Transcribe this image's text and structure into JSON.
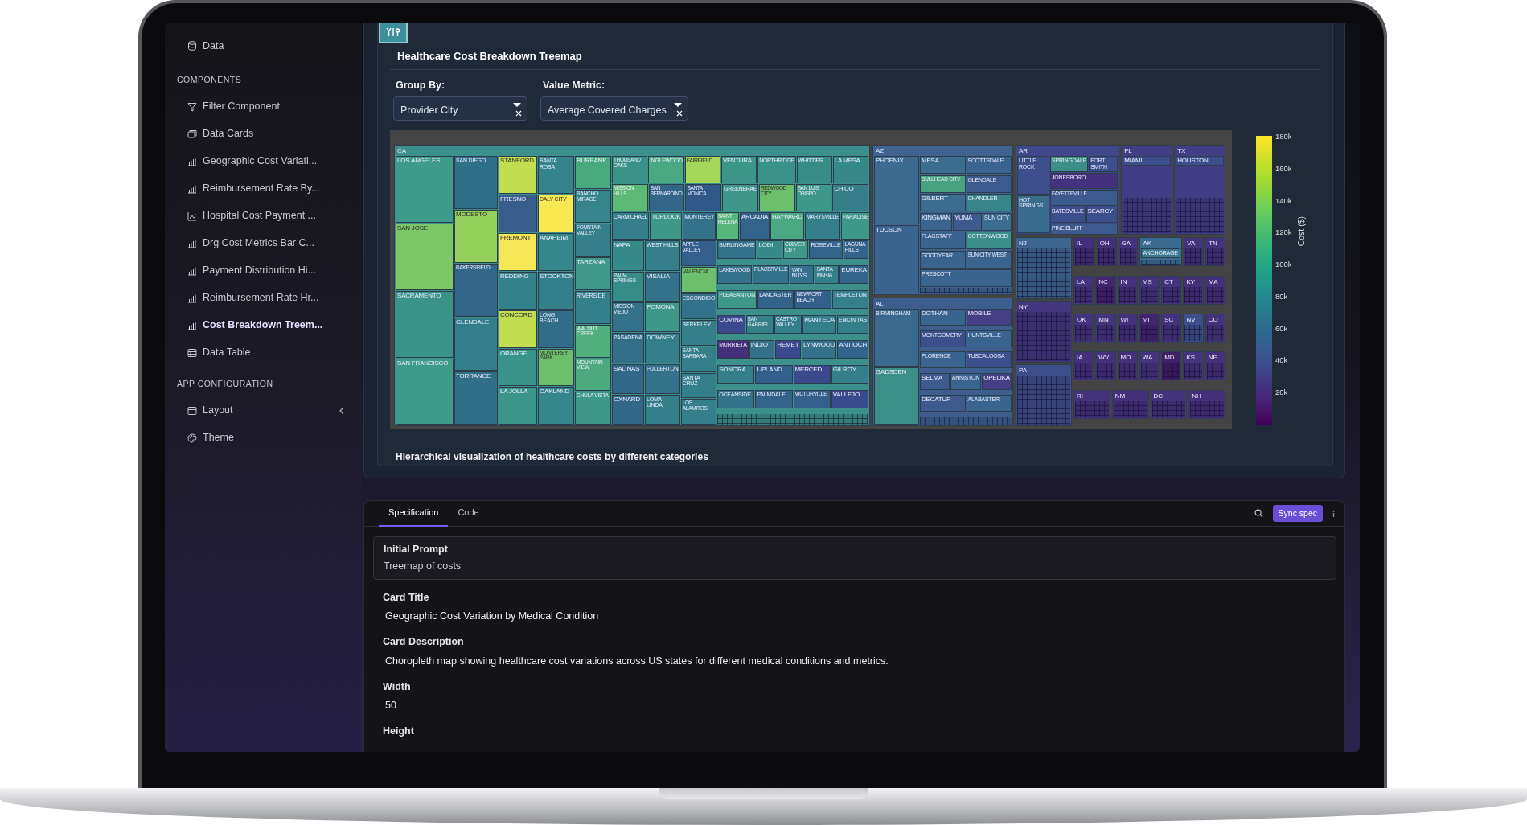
{
  "sidebar": {
    "sections": [
      {
        "items": [
          {
            "label": "Data",
            "kind": "database",
            "selected": false
          }
        ]
      },
      {
        "heading": "COMPONENTS",
        "items": [
          {
            "label": "Filter Component",
            "kind": "filter",
            "selected": false
          },
          {
            "label": "Data Cards",
            "kind": "cards",
            "selected": false
          },
          {
            "label": "Geographic Cost Variati...",
            "kind": "bars",
            "selected": false
          },
          {
            "label": "Reimbursement Rate By...",
            "kind": "bars",
            "selected": false
          },
          {
            "label": "Hospital Cost Payment ...",
            "kind": "scatter",
            "selected": false
          },
          {
            "label": "Drg Cost Metrics Bar C...",
            "kind": "bars",
            "selected": false
          },
          {
            "label": "Payment Distribution Hi...",
            "kind": "bars",
            "selected": false
          },
          {
            "label": "Reimbursement Rate Hr...",
            "kind": "bars",
            "selected": false
          },
          {
            "label": "Cost Breakdown Treem...",
            "kind": "bars",
            "selected": true
          },
          {
            "label": "Data Table",
            "kind": "table",
            "selected": false
          }
        ]
      },
      {
        "heading": "APP CONFIGURATION",
        "items": [
          {
            "label": "Layout",
            "kind": "layout",
            "selected": false
          },
          {
            "label": "Theme",
            "kind": "palette",
            "selected": false
          }
        ]
      }
    ]
  },
  "chart": {
    "title": "Healthcare Cost Breakdown Treemap",
    "filters": [
      {
        "label": "Group By:",
        "value": "Provider City"
      },
      {
        "label": "Value Metric:",
        "value": "Average Covered Charges"
      }
    ],
    "treemap": {
      "states": [
        {
          "label": "CA",
          "color": "#3c8f8a",
          "columns": [
            {
              "cells": [
                {
                  "label": "LOS ANGELES",
                  "color": "#3e9a89"
                },
                {
                  "label": "SAN JOSE",
                  "color": "#7bc767"
                },
                {
                  "label": "SACRAMENTO",
                  "color": "#3a9388"
                },
                {
                  "label": "SAN FRANCISCO",
                  "color": "#3e9a89"
                }
              ]
            },
            {
              "cells": [
                {
                  "label": "SAN DIEGO",
                  "color": "#2f6f87"
                },
                {
                  "label": "MODESTO",
                  "color": "#95d05c"
                },
                {
                  "label": "BAKERSFIELD",
                  "color": "#32668a"
                },
                {
                  "label": "GLENDALE",
                  "color": "#347d8a"
                },
                {
                  "label": "TORRANCE",
                  "color": "#316e88"
                }
              ]
            },
            {
              "cells": [
                {
                  "label": "STANFORD",
                  "color": "#c2de50"
                },
                {
                  "label": "FRESNO",
                  "color": "#365d8c"
                },
                {
                  "label": "FREMONT",
                  "color": "#f4e655"
                },
                {
                  "label": "REDDING",
                  "color": "#338189"
                },
                {
                  "label": "CONCORD",
                  "color": "#c2de50"
                },
                {
                  "label": "ORANGE",
                  "color": "#3a9388"
                },
                {
                  "label": "LA JOLLA",
                  "color": "#3b9589"
                }
              ]
            },
            {
              "cells": [
                {
                  "label": "SANTA ROSA",
                  "color": "#35848b"
                },
                {
                  "label": "DALY CITY",
                  "color": "#f7e751"
                },
                {
                  "label": "ANAHEIM",
                  "color": "#35878b"
                },
                {
                  "label": "STOCKTON",
                  "color": "#33808a"
                },
                {
                  "label": "LONG BEACH",
                  "color": "#316d88"
                },
                {
                  "label": "MONTEREY PARK",
                  "color": "#6ebf6c"
                },
                {
                  "label": "OAKLAND",
                  "color": "#35878b"
                }
              ]
            },
            {
              "cells": [
                {
                  "label": "BURBANK",
                  "color": "#49aa7f"
                },
                {
                  "label": "RANCHO MIRAGE",
                  "color": "#36858b"
                },
                {
                  "label": "FOUNTAIN VALLEY",
                  "color": "#357f8a"
                },
                {
                  "label": "TARZANA",
                  "color": "#3e9988"
                },
                {
                  "label": "RIVERSIDE",
                  "color": "#34808a"
                },
                {
                  "label": "WALNUT CREEK",
                  "color": "#52b07c"
                },
                {
                  "label": "MOUNTAIN VIEW",
                  "color": "#4daa80"
                },
                {
                  "label": "CHULA VISTA",
                  "color": "#3d9888"
                }
              ]
            }
          ],
          "top_strips": [
            {
              "cells": [
                {
                  "label": "THOUSAND OAKS",
                  "color": "#3a9188"
                },
                {
                  "label": "INGLEWOOD",
                  "color": "#4aa882"
                },
                {
                  "label": "FAIRFIELD",
                  "color": "#a5d85a"
                },
                {
                  "label": "VENTURA",
                  "color": "#3c9688"
                },
                {
                  "label": "NORTHRIDGE",
                  "color": "#3a9188"
                },
                {
                  "label": "WHITTIER",
                  "color": "#378c88"
                },
                {
                  "label": "LA MESA",
                  "color": "#368989"
                }
              ]
            },
            {
              "cells": [
                {
                  "label": "MISSION HILLS",
                  "color": "#5cba74"
                },
                {
                  "label": "SAN BERNARDINO",
                  "color": "#33678a"
                },
                {
                  "label": "SANTA MONICA",
                  "color": "#30598a"
                },
                {
                  "label": "GREENBRAE",
                  "color": "#3e9788"
                },
                {
                  "label": "REDWOOD CITY",
                  "color": "#6ebf6c"
                },
                {
                  "label": "SAN LUIS OBISPO",
                  "color": "#3e9788"
                },
                {
                  "label": "CHICO",
                  "color": "#347f8a"
                }
              ]
            },
            {
              "cells": [
                {
                  "label": "CARMICHAEL",
                  "color": "#357f8a"
                },
                {
                  "label": "TURLOCK",
                  "color": "#3e9788"
                },
                {
                  "label": "MONTEREY",
                  "color": "#33728a"
                },
                {
                  "label": "SAINT HELENA",
                  "color": "#55b57a"
                },
                {
                  "label": "ARCADIA",
                  "color": "#32648b"
                },
                {
                  "label": "HAYWARD",
                  "color": "#4aa882"
                },
                {
                  "label": "MARYSVILLE",
                  "color": "#357f8a"
                },
                {
                  "label": "PARADISE",
                  "color": "#3e9788"
                }
              ]
            }
          ],
          "sub_columns": [
            {
              "cells": [
                {
                  "label": "NAPA",
                  "color": "#368a89"
                },
                {
                  "label": "PALM SPRINGS",
                  "color": "#378c88"
                },
                {
                  "label": "MISSION VIEJO",
                  "color": "#33728a"
                },
                {
                  "label": "PASADENA",
                  "color": "#336f89"
                },
                {
                  "label": "SALINAS",
                  "color": "#32698b"
                },
                {
                  "label": "OXNARD",
                  "color": "#32698b"
                }
              ]
            },
            {
              "cells": [
                {
                  "label": "WEST HILLS",
                  "color": "#357f8a"
                },
                {
                  "label": "VISALIA",
                  "color": "#33728a"
                },
                {
                  "label": "POMONA",
                  "color": "#3e9788"
                },
                {
                  "label": "DOWNEY",
                  "color": "#357f8a"
                },
                {
                  "label": "FULLERTON",
                  "color": "#33728a"
                },
                {
                  "label": "LOMA LINDA",
                  "color": "#357f8a"
                }
              ]
            },
            {
              "cells": [
                {
                  "label": "APPLE VALLEY",
                  "color": "#325f8b"
                },
                {
                  "label": "VALENCIA",
                  "color": "#6ebf6c"
                },
                {
                  "label": "ESCONDIDO",
                  "color": "#33728a"
                },
                {
                  "label": "BERKELEY",
                  "color": "#357f8a"
                },
                {
                  "label": "SANTA BARBARA",
                  "color": "#357f8a"
                },
                {
                  "label": "SANTA CRUZ",
                  "color": "#357f8a"
                },
                {
                  "label": "LOS ALAMITOS",
                  "color": "#357f8a"
                }
              ]
            }
          ],
          "cells": [
            {
              "label": "BURLINGAME",
              "color": "#33728a"
            },
            {
              "label": "LODI",
              "color": "#368a89"
            },
            {
              "label": "CULVER CITY",
              "color": "#3e9788"
            },
            {
              "label": "ROSEVILLE",
              "color": "#32648b"
            },
            {
              "label": "LAGUNA HILLS",
              "color": "#32648b"
            },
            {
              "label": "LAKEWOOD",
              "color": "#33728a"
            },
            {
              "label": "PLACERVILLE",
              "color": "#33728a"
            },
            {
              "label": "VAN NUYS",
              "color": "#33728a"
            },
            {
              "label": "SANTA MARIA",
              "color": "#357f8a"
            },
            {
              "label": "EUREKA",
              "color": "#32648b"
            },
            {
              "label": "PLEASANTON",
              "color": "#3e9788"
            },
            {
              "label": "LANCASTER",
              "color": "#32648b"
            },
            {
              "label": "NEWPORT BEACH",
              "color": "#325f8b"
            },
            {
              "label": "TEMPLETON",
              "color": "#357f8a"
            },
            {
              "label": "COVINA",
              "color": "#3b4a8c"
            },
            {
              "label": "SAN GABRIEL",
              "color": "#357f8a"
            },
            {
              "label": "CASTRO VALLEY",
              "color": "#357f8a"
            },
            {
              "label": "MANTECA",
              "color": "#357f8a"
            },
            {
              "label": "ENCINITAS",
              "color": "#357f8a"
            },
            {
              "label": "MURRIETA",
              "color": "#45307c"
            },
            {
              "label": "INDIO",
              "color": "#33728a"
            },
            {
              "label": "HEMET",
              "color": "#3b4a8c"
            },
            {
              "label": "LYNWOOD",
              "color": "#33728a"
            },
            {
              "label": "ANTIOCH",
              "color": "#32648b"
            },
            {
              "label": "SONORA",
              "color": "#357f8a"
            },
            {
              "label": "UPLAND",
              "color": "#325f8b"
            },
            {
              "label": "MERCED",
              "color": "#3b4a8c"
            },
            {
              "label": "GILROY",
              "color": "#357f8a"
            },
            {
              "label": "OCEANSIDE",
              "color": "#33728a"
            },
            {
              "label": "PALMDALE",
              "color": "#32648b"
            },
            {
              "label": "VICTORVILLE",
              "color": "#325f8b"
            },
            {
              "label": "VALLEJO",
              "color": "#3b4a8c"
            }
          ]
        },
        {
          "label": "AZ",
          "color": "#3e6390",
          "main": [
            {
              "label": "PHOENIX",
              "color": "#3c6b92"
            },
            {
              "label": "TUCSON",
              "color": "#3a6490"
            }
          ],
          "cells": [
            {
              "label": "MESA",
              "color": "#3a6d90"
            },
            {
              "label": "SCOTTSDALE",
              "color": "#3a6490"
            },
            {
              "label": "BULLHEAD CITY",
              "color": "#48a282"
            },
            {
              "label": "GLENDALE",
              "color": "#3c5a8e"
            },
            {
              "label": "GILBERT",
              "color": "#3a6d90"
            },
            {
              "label": "CHANDLER",
              "color": "#388589"
            },
            {
              "label": "KINGMAN",
              "color": "#3a6490"
            },
            {
              "label": "YUMA",
              "color": "#3c5a8e"
            },
            {
              "label": "SUN CITY",
              "color": "#3a6d90"
            },
            {
              "label": "FLAGSTAFF",
              "color": "#3a6490"
            },
            {
              "label": "COTTONWOOD",
              "color": "#3b8e88"
            },
            {
              "label": "GOODYEAR",
              "color": "#3a6490"
            },
            {
              "label": "SUN CITY WEST",
              "color": "#3a6490"
            },
            {
              "label": "PRESCOTT",
              "color": "#3a6490"
            }
          ]
        },
        {
          "label": "AL",
          "color": "#3d5d8f",
          "main": [
            {
              "label": "BIRMINGHAM",
              "color": "#3a6a90"
            },
            {
              "label": "GADSDEN",
              "color": "#3c8f89"
            }
          ],
          "cells": [
            {
              "label": "DOTHAN",
              "color": "#3a6490"
            },
            {
              "label": "MOBILE",
              "color": "#463f86"
            },
            {
              "label": "MONTGOMERY",
              "color": "#3c4f8c"
            },
            {
              "label": "HUNTSVILLE",
              "color": "#3a6490"
            },
            {
              "label": "FLORENCE",
              "color": "#3a6490"
            },
            {
              "label": "TUSCALOOSA",
              "color": "#3c4f8c"
            },
            {
              "label": "SELMA",
              "color": "#3c5a8e"
            },
            {
              "label": "ANNISTON",
              "color": "#3a6490"
            },
            {
              "label": "OPELIKA",
              "color": "#463f86"
            },
            {
              "label": "DECATUR",
              "color": "#3c5a8e"
            },
            {
              "label": "ALABASTER",
              "color": "#3a6490"
            }
          ]
        },
        {
          "label": "AR",
          "color": "#40478a",
          "main": [
            {
              "label": "LITTLE ROCK",
              "color": "#3c4f8c"
            },
            {
              "label": "HOT SPRINGS",
              "color": "#3a6c90"
            }
          ],
          "cells": [
            {
              "label": "SPRINGDALE",
              "color": "#3c8f89"
            },
            {
              "label": "FORT SMITH",
              "color": "#3c4f8c"
            },
            {
              "label": "JONESBORO",
              "color": "#45327e"
            },
            {
              "label": "FAYETTEVILLE",
              "color": "#3c5a8e"
            },
            {
              "label": "BATESVILLE",
              "color": "#3c4f8c"
            },
            {
              "label": "SEARCY",
              "color": "#3c4f8c"
            },
            {
              "label": "PINE BLUFF",
              "color": "#3c5a8e"
            }
          ]
        },
        {
          "label": "FL",
          "color": "#433d85",
          "cells": [
            {
              "label": "MIAMI",
              "color": "#3c4f8c"
            }
          ]
        },
        {
          "label": "TX",
          "color": "#433d85",
          "cells": [
            {
              "label": "HOUSTON",
              "color": "#3c4f8c"
            }
          ]
        },
        {
          "label": "NJ",
          "color": "#3c6590"
        },
        {
          "label": "NY",
          "color": "#44377f"
        },
        {
          "label": "PA",
          "color": "#3e4e8b"
        },
        {
          "label": "IL",
          "color": "#442f7a"
        },
        {
          "label": "OH",
          "color": "#442f7a"
        },
        {
          "label": "GA",
          "color": "#44337d"
        },
        {
          "label": "AK",
          "color": "#3a6a90",
          "cells": [
            {
              "label": "ANCHORAGE",
              "color": "#3a7a90"
            }
          ]
        },
        {
          "label": "VA",
          "color": "#44337d"
        },
        {
          "label": "TN",
          "color": "#44337d"
        },
        {
          "label": "LA",
          "color": "#44337d"
        },
        {
          "label": "NC",
          "color": "#42256f"
        },
        {
          "label": "IN",
          "color": "#44307b"
        },
        {
          "label": "MS",
          "color": "#44337d"
        },
        {
          "label": "CT",
          "color": "#44337d"
        },
        {
          "label": "KY",
          "color": "#44307b"
        },
        {
          "label": "MA",
          "color": "#44307b"
        },
        {
          "label": "OK",
          "color": "#44337d"
        },
        {
          "label": "MN",
          "color": "#44337d"
        },
        {
          "label": "WI",
          "color": "#44307b"
        },
        {
          "label": "MI",
          "color": "#42256f"
        },
        {
          "label": "SC",
          "color": "#44337d"
        },
        {
          "label": "NV",
          "color": "#3c4f8c"
        },
        {
          "label": "CO",
          "color": "#44337d"
        },
        {
          "label": "IA",
          "color": "#44307b"
        },
        {
          "label": "WV",
          "color": "#44307b"
        },
        {
          "label": "MO",
          "color": "#44307b"
        },
        {
          "label": "WA",
          "color": "#44337d"
        },
        {
          "label": "MD",
          "color": "#3f1f66"
        },
        {
          "label": "KS",
          "color": "#44337d"
        },
        {
          "label": "NE",
          "color": "#44307b"
        },
        {
          "label": "RI",
          "color": "#44337d"
        },
        {
          "label": "NM",
          "color": "#44307b"
        },
        {
          "label": "DC",
          "color": "#44337d"
        },
        {
          "label": "NH",
          "color": "#44307b"
        }
      ]
    },
    "colorbar": {
      "title": "Cost ($)",
      "ticks": [
        "180k",
        "160k",
        "140k",
        "120k",
        "100k",
        "80k",
        "60k",
        "40k",
        "20k"
      ]
    },
    "caption": "Hierarchical visualization of healthcare costs by different categories"
  },
  "spec_panel": {
    "tabs": [
      {
        "label": "Specification",
        "selected": true
      },
      {
        "label": "Code",
        "selected": false
      }
    ],
    "action": "Sync spec",
    "prompt": {
      "label": "Initial Prompt",
      "value": "Treemap of costs"
    },
    "fields": [
      {
        "label": "Card Title",
        "value": "Geographic Cost Variation by Medical Condition"
      },
      {
        "label": "Card Description",
        "value": "Choropleth map showing healthcare cost variations across US states for different medical conditions and metrics."
      },
      {
        "label": "Width",
        "value": "50"
      },
      {
        "label": "Height"
      }
    ]
  }
}
